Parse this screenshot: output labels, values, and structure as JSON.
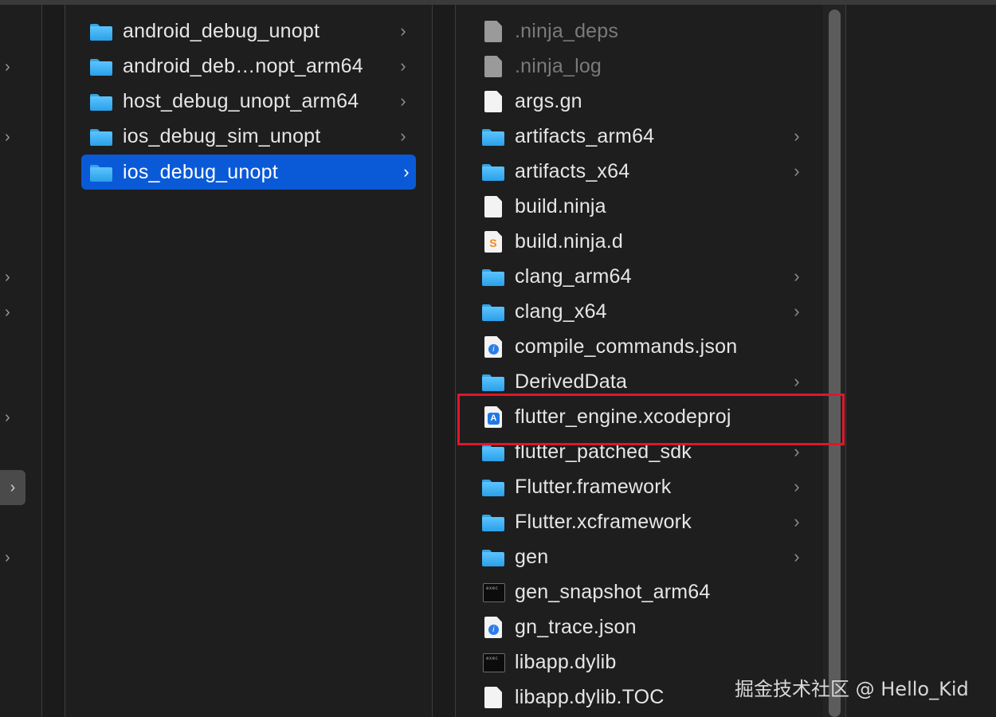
{
  "column_middle": {
    "items": [
      {
        "label": "android_debug_unopt",
        "type": "folder"
      },
      {
        "label": "android_deb…nopt_arm64",
        "type": "folder"
      },
      {
        "label": "host_debug_unopt_arm64",
        "type": "folder"
      },
      {
        "label": "ios_debug_sim_unopt",
        "type": "folder"
      },
      {
        "label": "ios_debug_unopt",
        "type": "folder",
        "selected": true
      }
    ]
  },
  "column_right": {
    "items": [
      {
        "label": ".ninja_deps",
        "type": "doc-grey"
      },
      {
        "label": ".ninja_log",
        "type": "doc-grey"
      },
      {
        "label": "args.gn",
        "type": "doc"
      },
      {
        "label": "artifacts_arm64",
        "type": "folder"
      },
      {
        "label": "artifacts_x64",
        "type": "folder"
      },
      {
        "label": "build.ninja",
        "type": "doc"
      },
      {
        "label": "build.ninja.d",
        "type": "sublime"
      },
      {
        "label": "clang_arm64",
        "type": "folder"
      },
      {
        "label": "clang_x64",
        "type": "folder"
      },
      {
        "label": "compile_commands.json",
        "type": "json"
      },
      {
        "label": "DerivedData",
        "type": "folder"
      },
      {
        "label": "flutter_engine.xcodeproj",
        "type": "xcode",
        "highlighted": true
      },
      {
        "label": "flutter_patched_sdk",
        "type": "folder"
      },
      {
        "label": "Flutter.framework",
        "type": "folder"
      },
      {
        "label": "Flutter.xcframework",
        "type": "folder"
      },
      {
        "label": "gen",
        "type": "folder"
      },
      {
        "label": "gen_snapshot_arm64",
        "type": "exec"
      },
      {
        "label": "gn_trace.json",
        "type": "json"
      },
      {
        "label": "libapp.dylib",
        "type": "exec"
      },
      {
        "label": "libapp.dylib.TOC",
        "type": "doc"
      }
    ]
  },
  "glyphs": {
    "chevron": "›",
    "sublime": "S",
    "json": "i",
    "xcode": "A",
    "terminal": "exec"
  },
  "watermark": "掘金技术社区 @ Hello_Kid",
  "colors": {
    "background": "#1e1e1e",
    "selection": "#0a5ad8",
    "highlight_box": "#e0162b",
    "folder": "#33a3e6"
  }
}
